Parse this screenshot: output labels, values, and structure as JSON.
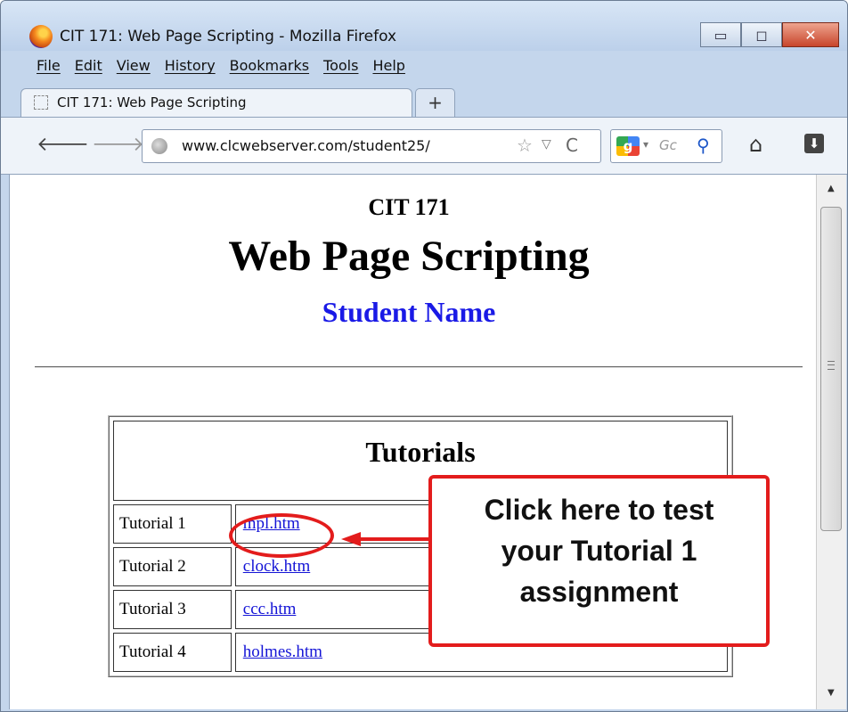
{
  "window": {
    "title": "CIT 171: Web Page Scripting - Mozilla Firefox",
    "min_glyph": "▭",
    "max_glyph": "◻",
    "close_glyph": "✕"
  },
  "menu": {
    "items": [
      "File",
      "Edit",
      "View",
      "History",
      "Bookmarks",
      "Tools",
      "Help"
    ]
  },
  "tabs": [
    {
      "label": "CIT 171: Web Page Scripting"
    }
  ],
  "new_tab_glyph": "+",
  "nav": {
    "back_glyph": "🡐",
    "forward_glyph": "🡒",
    "url": "www.clcwebserver.com/student25/",
    "star_glyph": "☆",
    "drop_glyph": "▽",
    "reload_glyph": "C",
    "search_engine_glyph": "g",
    "search_drop_glyph": "▾",
    "search_placeholder": "Gc",
    "search_glyph": "⚲",
    "home_glyph": "⌂",
    "download_glyph": "⬇"
  },
  "page": {
    "course": "CIT 171",
    "title": "Web Page Scripting",
    "student": "Student Name",
    "table_header": "Tutorials",
    "rows": [
      {
        "label": "Tutorial 1",
        "link": "mpl.htm"
      },
      {
        "label": "Tutorial 2",
        "link": "clock.htm"
      },
      {
        "label": "Tutorial 3",
        "link": "ccc.htm"
      },
      {
        "label": "Tutorial 4",
        "link": "holmes.htm"
      }
    ]
  },
  "callout": {
    "lines": [
      "Click here to test",
      "your Tutorial 1",
      "assignment"
    ]
  },
  "scrollbar": {
    "up_glyph": "▲",
    "down_glyph": "▼"
  },
  "colors": {
    "accent_red": "#e31c1c",
    "link_blue": "#1414d6",
    "student_blue": "#1a1ae6"
  }
}
